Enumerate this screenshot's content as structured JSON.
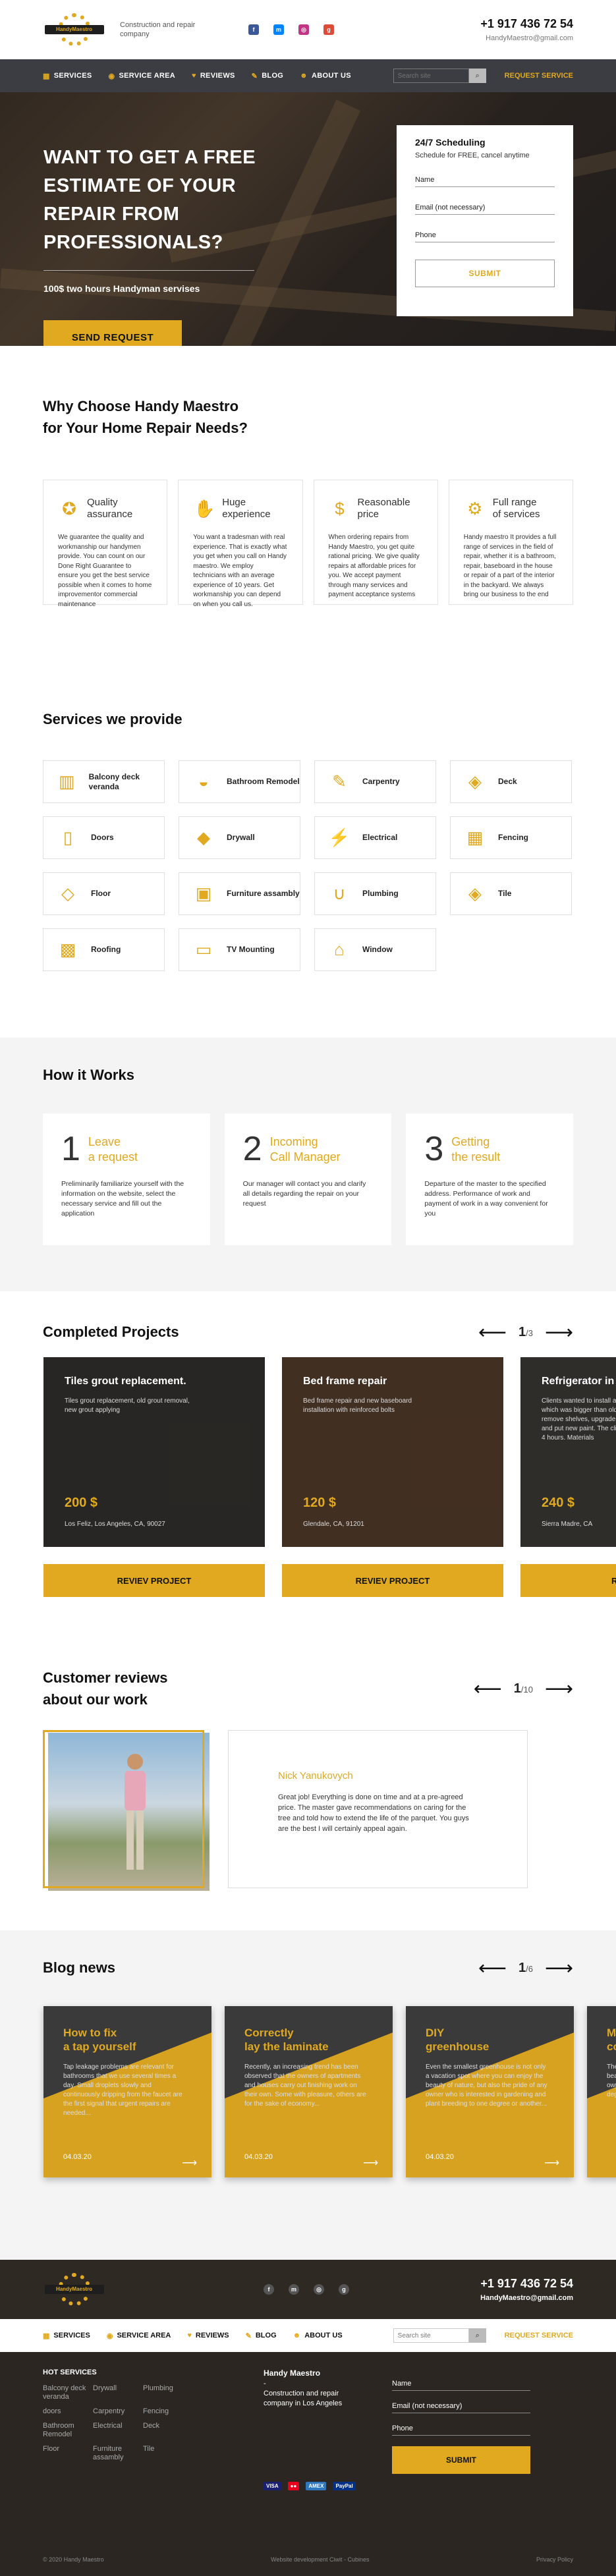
{
  "brand": {
    "logo_text": "HandyMaestro",
    "tagline": "Construction and repair company"
  },
  "contact": {
    "phone": "+1 917 436 72 54",
    "email": "HandyMaestro@gmail.com"
  },
  "socials": [
    "facebook-icon",
    "messenger-icon",
    "instagram-icon",
    "google-plus-icon"
  ],
  "nav": {
    "items": [
      {
        "label": "SERVICES",
        "icon": "grid-icon"
      },
      {
        "label": "SERVICE AREA",
        "icon": "map-pin-icon"
      },
      {
        "label": "REVIEWS",
        "icon": "thumb-icon"
      },
      {
        "label": "BLOG",
        "icon": "pen-icon"
      },
      {
        "label": "ABOUT US",
        "icon": "people-icon"
      }
    ],
    "search_placeholder": "Search site",
    "request_label": "REQUEST SERVICE"
  },
  "hero": {
    "title": "WANT TO GET A FREE ESTIMATE OF YOUR REPAIR FROM PROFESSIONALS?",
    "subtitle": "100$ two hours Handyman servises",
    "cta": "SEND REQUEST",
    "form": {
      "title": "24/7 Scheduling",
      "note": "Schedule for FREE, cancel anytime",
      "fields": [
        "Name",
        "Email (not necessary)",
        "Phone"
      ],
      "submit": "SUBMIT"
    }
  },
  "why": {
    "title_line1": "Why Choose Handy Maestro",
    "title_line2": "for Your Home Repair Needs?",
    "cards": [
      {
        "title1": "Quality",
        "title2": "assurance",
        "icon": "medal-icon",
        "text": "We guarantee the quality and workmanship our handymen provide. You can count on our Done Right Guarantee to ensure you get the best service possible when it comes to home improvementor commercial maintenance"
      },
      {
        "title1": "Huge",
        "title2": "experience",
        "icon": "handshake-icon",
        "text": "You want a tradesman with real experience. That is exactly what you get when you call on Handy maestro. We employ technicians with an average experience of 10 years. Get workmanship you can depend on when you call us."
      },
      {
        "title1": "Reasonable",
        "title2": "price",
        "icon": "money-hand-icon",
        "text": "When ordering repairs from Handy Maestro, you get quite rational pricing. We give quality repairs at affordable prices for you. We accept payment through many services and payment acceptance systems"
      },
      {
        "title1": "Full range",
        "title2": "of services",
        "icon": "gear-icon",
        "text": "Handy maestro It provides a full range of services in the field of repair, whether it is a bathroom, repair, baseboard in the house or repair of a part of the interior in the backyard. We always bring our business to the end"
      }
    ]
  },
  "services": {
    "title": "Services we provide",
    "items": [
      {
        "label": "Balcony deck veranda",
        "icon": "balcony-icon",
        "glyph": "▥"
      },
      {
        "label": "Bathroom Remodel",
        "icon": "bathtub-icon",
        "glyph": "◒"
      },
      {
        "label": "Carpentry",
        "icon": "hammer-icon",
        "glyph": "✎"
      },
      {
        "label": "Deck",
        "icon": "deck-icon",
        "glyph": "◈"
      },
      {
        "label": "Doors",
        "icon": "door-icon",
        "glyph": "▯"
      },
      {
        "label": "Drywall",
        "icon": "drywall-icon",
        "glyph": "◆"
      },
      {
        "label": "Electrical",
        "icon": "plug-icon",
        "glyph": "⚡"
      },
      {
        "label": "Fencing",
        "icon": "fence-icon",
        "glyph": "▦"
      },
      {
        "label": "Floor",
        "icon": "floor-icon",
        "glyph": "◇"
      },
      {
        "label": "Furniture assambly",
        "icon": "furniture-icon",
        "glyph": "▣"
      },
      {
        "label": "Plumbing",
        "icon": "pipe-icon",
        "glyph": "∪"
      },
      {
        "label": "Tile",
        "icon": "tile-icon",
        "glyph": "◈"
      },
      {
        "label": "Roofing",
        "icon": "roof-icon",
        "glyph": "▩"
      },
      {
        "label": "TV Mounting",
        "icon": "tv-icon",
        "glyph": "▭"
      },
      {
        "label": "Window",
        "icon": "window-icon",
        "glyph": "⌂"
      }
    ]
  },
  "how": {
    "title": "How it Works",
    "steps": [
      {
        "num": "1",
        "t1": "Leave",
        "t2": "a request",
        "text": "Preliminarily familiarize yourself with the information on the website, select the necessary service and fill out the application"
      },
      {
        "num": "2",
        "t1": "Incoming",
        "t2": "Call Manager",
        "text": "Our manager will contact you and clarify all details regarding the repair on your request"
      },
      {
        "num": "3",
        "t1": "Getting",
        "t2": "the result",
        "text": "Departure of the master to the specified address. Performance of work and payment of work in a way convenient for you"
      }
    ]
  },
  "projects": {
    "title": "Completed Projects",
    "page": "1",
    "total": "/3",
    "items": [
      {
        "title": "Tiles grout replacement.",
        "text": "Tiles grout replacement,  old grout removal, new grout applying",
        "price": "200 $",
        "loc": "Los Feliz, Los Angeles, CA, 90027",
        "btn": "REVIEV PROJECT",
        "bg": "#3d3a36"
      },
      {
        "title": "Bed frame repair",
        "text": "Bed frame repair and new baseboard installation with reinforced bolts",
        "price": "120 $",
        "loc": "Glendale, CA, 91201",
        "btn": "REVIEV PROJECT",
        "bg": "#6b4a30"
      },
      {
        "title": "Refrigerator in",
        "text": "Clients wanted to install a refrigerator which was bigger than old one. We had to remove shelves, upgrade doors, cut out and put new paint. The clients are happy! 4 hours. Materials",
        "price": "240 $",
        "loc": "Sierra Madre, CA",
        "btn": "REVIEV P",
        "bg": "#4a4540"
      }
    ]
  },
  "reviews": {
    "title_line1": "Customer reviews",
    "title_line2": "about our work",
    "page": "1",
    "total": "/10",
    "name": "Nick Yanukovych",
    "text": "Great job! Everything is done on time and at a pre-agreed price. The master gave recommendations on caring for the tree and told how to extend the life of the parquet. You guys are the best I will certainly appeal again."
  },
  "blog": {
    "title": "Blog news",
    "page": "1",
    "total": "/6",
    "items": [
      {
        "t1": "How to fix",
        "t2": "a tap yourself",
        "text": "Tap leakage problems are relevant for bathrooms that we use several times a day. Small droplets slowly and continuously dripping from the faucet are the first signal that urgent repairs are needed...",
        "date": "04.03.20"
      },
      {
        "t1": "Correctly",
        "t2": "lay the laminate",
        "text": "Recently, an increasing trend has been observed that the owners of apartments and houses carry out finishing work on their own. Some with pleasure, others are for the sake of economy...",
        "date": "04.03.20"
      },
      {
        "t1": "DIY",
        "t2": "greenhouse",
        "text": "Even the smallest greenhouse is not only a vacation spot where you can enjoy the beauty of nature, but also the pride of any owner who is interested in gardening and plant breeding to one degree or another...",
        "date": "04.03.20"
      },
      {
        "t1": "Ma",
        "t2": "co",
        "text": "The smallest greenhouse is also the beauty of nature and the pride of any owner interested in breeding to one degree or another...",
        "date": ""
      }
    ]
  },
  "footer": {
    "hot_title": "HOT SERVICES",
    "hot": [
      "Balcony deck veranda",
      "Drywall",
      "Plumbing",
      "doors",
      "Carpentry",
      "Fencing",
      "Bathroom Remodel",
      "Electrical",
      "Deck",
      "Floor",
      "Furniture assambly",
      "Tile"
    ],
    "company_name": "Handy Maestro",
    "company_dash": "-",
    "company_desc": "Construction and repair company in Los Angeles",
    "payments": [
      "VISA",
      "●●",
      "AMEX",
      "PayPal"
    ],
    "form_fields": [
      "Name",
      "Email (not necessary)",
      "Phone"
    ],
    "submit": "SUBMIT",
    "copyright": "© 2020 Handy Maestro",
    "dev": "Website development Ciwit - Cubines",
    "privacy": "Privacy Policy"
  }
}
